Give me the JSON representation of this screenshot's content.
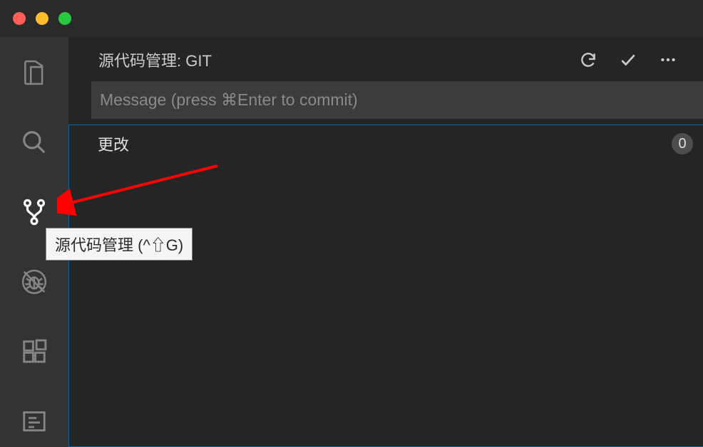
{
  "panel": {
    "title": "源代码管理: GIT"
  },
  "commit": {
    "placeholder": "Message (press ⌘Enter to commit)"
  },
  "changes": {
    "label": "更改",
    "count": "0"
  },
  "tooltip": {
    "text": "源代码管理 (^⇧G)"
  }
}
